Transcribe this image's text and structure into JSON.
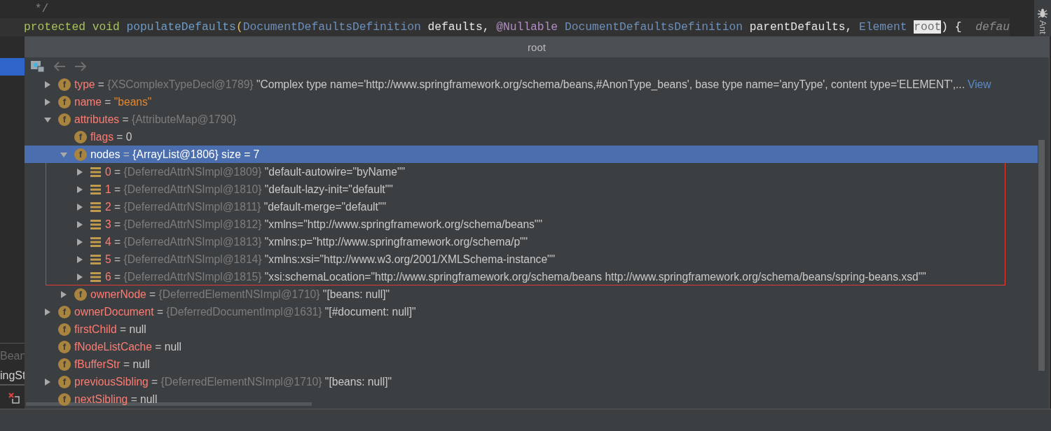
{
  "editor": {
    "lines": [
      [
        {
          "text": " */",
          "kind": "comment"
        }
      ],
      [
        {
          "text": "protected void ",
          "kind": "keyword"
        },
        {
          "text": "populateDefaults",
          "kind": "method"
        },
        {
          "text": "(",
          "kind": "paren"
        },
        {
          "text": "DocumentDefaultsDefinition ",
          "kind": "type"
        },
        {
          "text": "defaults, ",
          "kind": "plain"
        },
        {
          "text": "@Nullable ",
          "kind": "annotation"
        },
        {
          "text": "DocumentDefaultsDefinition ",
          "kind": "type"
        },
        {
          "text": "parentDefaults, ",
          "kind": "plain"
        },
        {
          "text": "Element ",
          "kind": "type"
        },
        {
          "text": "root",
          "kind": "highlight"
        },
        {
          "text": ") {  ",
          "kind": "plain"
        },
        {
          "text": "defau",
          "kind": "hint"
        }
      ]
    ]
  },
  "tool_window": {
    "label": "Ant"
  },
  "left_panel": {
    "tab_label": "Bean",
    "item_label": "ingSt"
  },
  "popup": {
    "title": "root",
    "separator": "=",
    "tree": [
      {
        "kind": "field",
        "icon_letter": "f",
        "name": "type",
        "ref": "{XSComplexTypeDecl@1789}",
        "value": "\"Complex type name='http://www.springframework.org/schema/beans,#AnonType_beans', base type name='anyType', content type='ELEMENT',...",
        "link": "View",
        "expanded": false,
        "selected": false
      },
      {
        "kind": "field",
        "icon_letter": "f",
        "name": "name",
        "value": "\"beans\"",
        "color": "#e5862d",
        "expanded": false,
        "selected": false
      },
      {
        "kind": "field",
        "icon_letter": "f",
        "name": "attributes",
        "ref": "{AttributeMap@1790}",
        "expanded": true,
        "selected": false,
        "children": [
          {
            "kind": "field",
            "icon_letter": "f",
            "name": "flags",
            "value": "0",
            "selected": false
          },
          {
            "kind": "field",
            "icon_letter": "f",
            "name": "nodes",
            "ref": "{ArrayList@1806}",
            "value": "size = 7",
            "expanded": true,
            "selected": true,
            "annotated": true,
            "children": [
              {
                "kind": "item",
                "name": "0",
                "ref": "{DeferredAttrNSImpl@1809}",
                "value": "\"default-autowire=\"byName\"\"",
                "expanded": false,
                "selected": false
              },
              {
                "kind": "item",
                "name": "1",
                "ref": "{DeferredAttrNSImpl@1810}",
                "value": "\"default-lazy-init=\"default\"\"",
                "expanded": false,
                "selected": false
              },
              {
                "kind": "item",
                "name": "2",
                "ref": "{DeferredAttrNSImpl@1811}",
                "value": "\"default-merge=\"default\"\"",
                "expanded": false,
                "selected": false
              },
              {
                "kind": "item",
                "name": "3",
                "ref": "{DeferredAttrNSImpl@1812}",
                "value": "\"xmlns=\"http://www.springframework.org/schema/beans\"\"",
                "expanded": false,
                "selected": false
              },
              {
                "kind": "item",
                "name": "4",
                "ref": "{DeferredAttrNSImpl@1813}",
                "value": "\"xmlns:p=\"http://www.springframework.org/schema/p\"\"",
                "expanded": false,
                "selected": false
              },
              {
                "kind": "item",
                "name": "5",
                "ref": "{DeferredAttrNSImpl@1814}",
                "value": "\"xmlns:xsi=\"http://www.w3.org/2001/XMLSchema-instance\"\"",
                "expanded": false,
                "selected": false
              },
              {
                "kind": "item",
                "name": "6",
                "ref": "{DeferredAttrNSImpl@1815}",
                "value": "\"xsi:schemaLocation=\"http://www.springframework.org/schema/beans http://www.springframework.org/schema/beans/spring-beans.xsd\"\"",
                "expanded": false,
                "selected": false
              }
            ]
          },
          {
            "kind": "field",
            "icon_letter": "f",
            "name": "ownerNode",
            "ref": "{DeferredElementNSImpl@1710}",
            "value": "\"[beans: null]\"",
            "expanded": false,
            "selected": false
          }
        ]
      },
      {
        "kind": "field",
        "icon_letter": "f",
        "name": "ownerDocument",
        "ref": "{DeferredDocumentImpl@1631}",
        "value": "\"[#document: null]\"",
        "expanded": false,
        "selected": false
      },
      {
        "kind": "field",
        "icon_letter": "f",
        "name": "firstChild",
        "value": "null",
        "selected": false
      },
      {
        "kind": "field",
        "icon_letter": "f",
        "name": "fNodeListCache",
        "value": "null",
        "selected": false
      },
      {
        "kind": "field",
        "icon_letter": "f",
        "name": "fBufferStr",
        "value": "null",
        "selected": false
      },
      {
        "kind": "field",
        "icon_letter": "f",
        "name": "previousSibling",
        "ref": "{DeferredElementNSImpl@1710}",
        "value": "\"[beans: null]\"",
        "expanded": false,
        "selected": false
      },
      {
        "kind": "field",
        "icon_letter": "f",
        "name": "nextSibling",
        "value": "null",
        "selected": false
      }
    ]
  }
}
